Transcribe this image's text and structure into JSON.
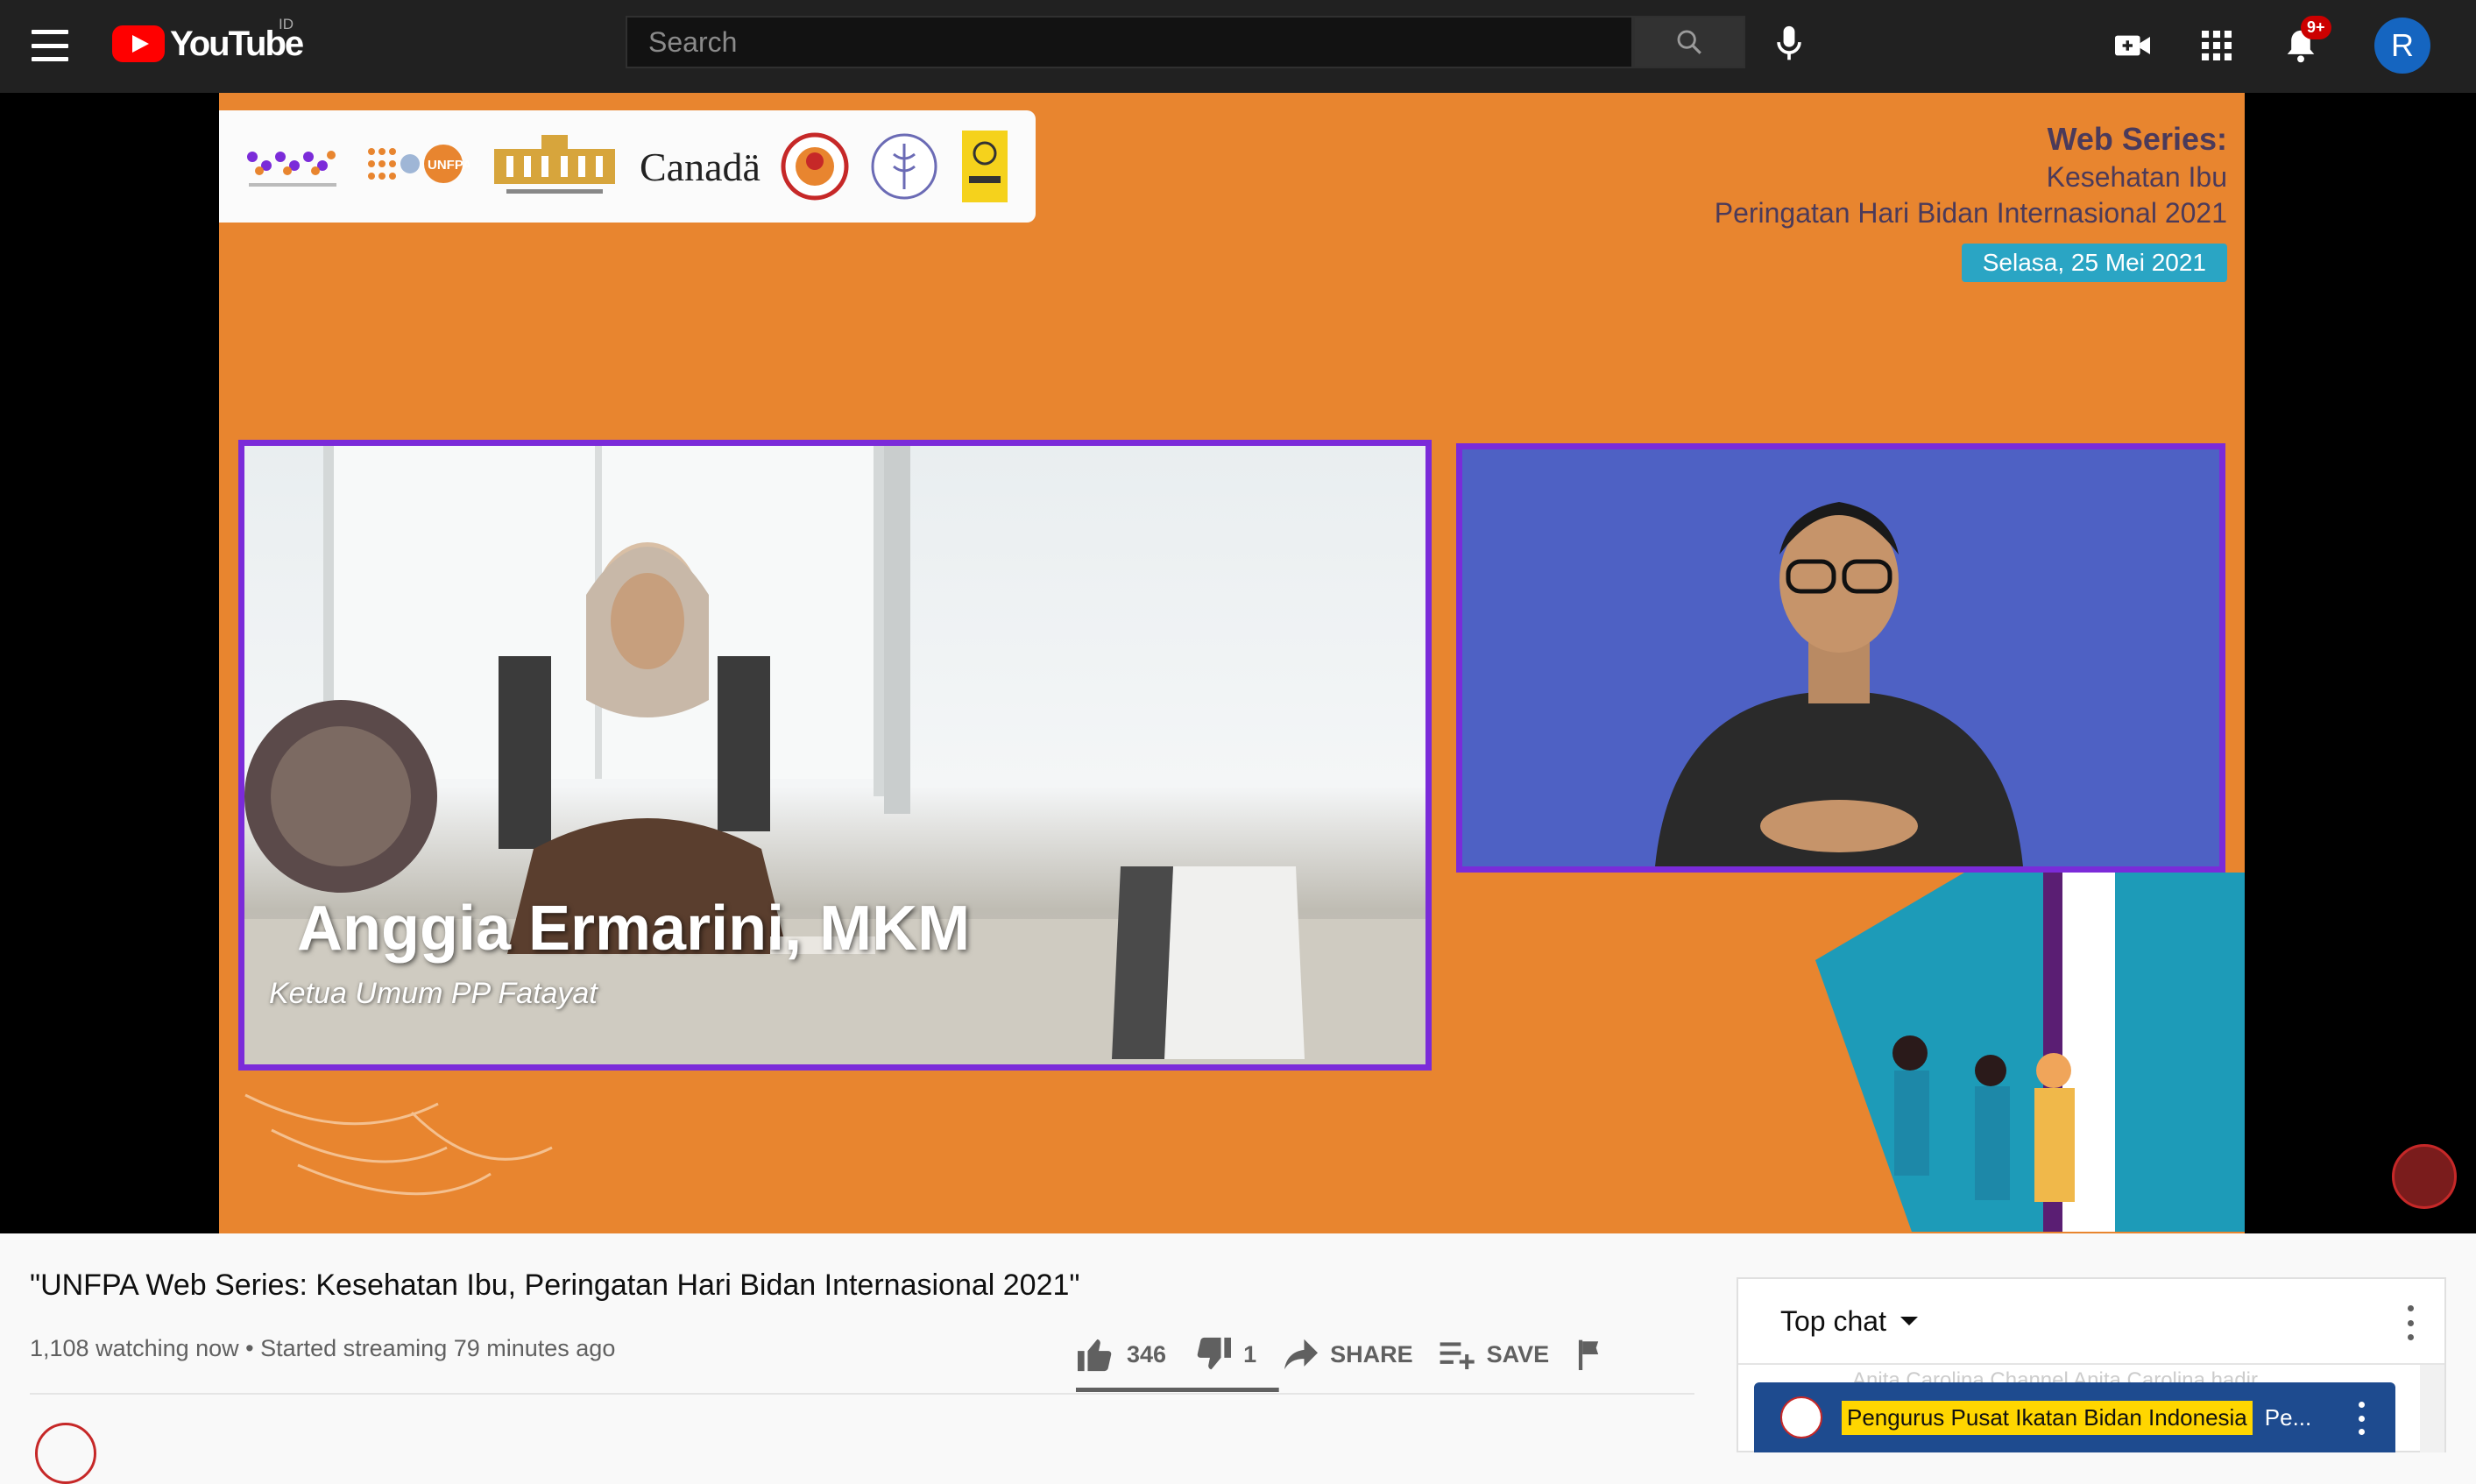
{
  "header": {
    "logo_text": "YouTube",
    "country_code": "ID",
    "search_placeholder": "Search",
    "notification_count": "9+",
    "avatar_letter": "R",
    "icons": [
      "menu-icon",
      "youtube-logo",
      "search-icon",
      "mic-icon",
      "create-video-icon",
      "apps-icon",
      "bell-icon"
    ]
  },
  "video_frame": {
    "sponsor_logos": [
      "Knowledge Hub",
      "UNFPA",
      "Kantor Staf Presiden",
      "Canada",
      "Fatayat",
      "IBI",
      "UI"
    ],
    "canada_wordmark": "Canadä",
    "series_title_1": "Web Series:",
    "series_title_2": "Kesehatan Ibu",
    "series_title_3": "Peringatan Hari Bidan Internasional 2021",
    "series_date": "Selasa, 25 Mei 2021",
    "speaker_name": "Anggia Ermarini, MKM",
    "speaker_role": "Ketua Umum PP Fatayat",
    "colors": {
      "background": "#e8852f",
      "frame_border": "#7b2bd9",
      "sign_panel": "#4e61c4",
      "date_badge": "#2aa5c4"
    }
  },
  "video_info": {
    "title": "\"UNFPA Web Series: Kesehatan Ibu, Peringatan Hari Bidan Internasional 2021\"",
    "meta": "1,108 watching now • Started streaming 79 minutes ago",
    "likes": "346",
    "dislikes": "1",
    "like_ratio": 0.997,
    "share_label": "SHARE",
    "save_label": "SAVE"
  },
  "chat": {
    "mode": "Top chat",
    "ghost_message": "Anita Carolina Channel  Anita Carolina hadir",
    "pinned_author": "Pengurus Pusat Ikatan Bidan Indonesia",
    "pinned_text": "Pe..."
  }
}
